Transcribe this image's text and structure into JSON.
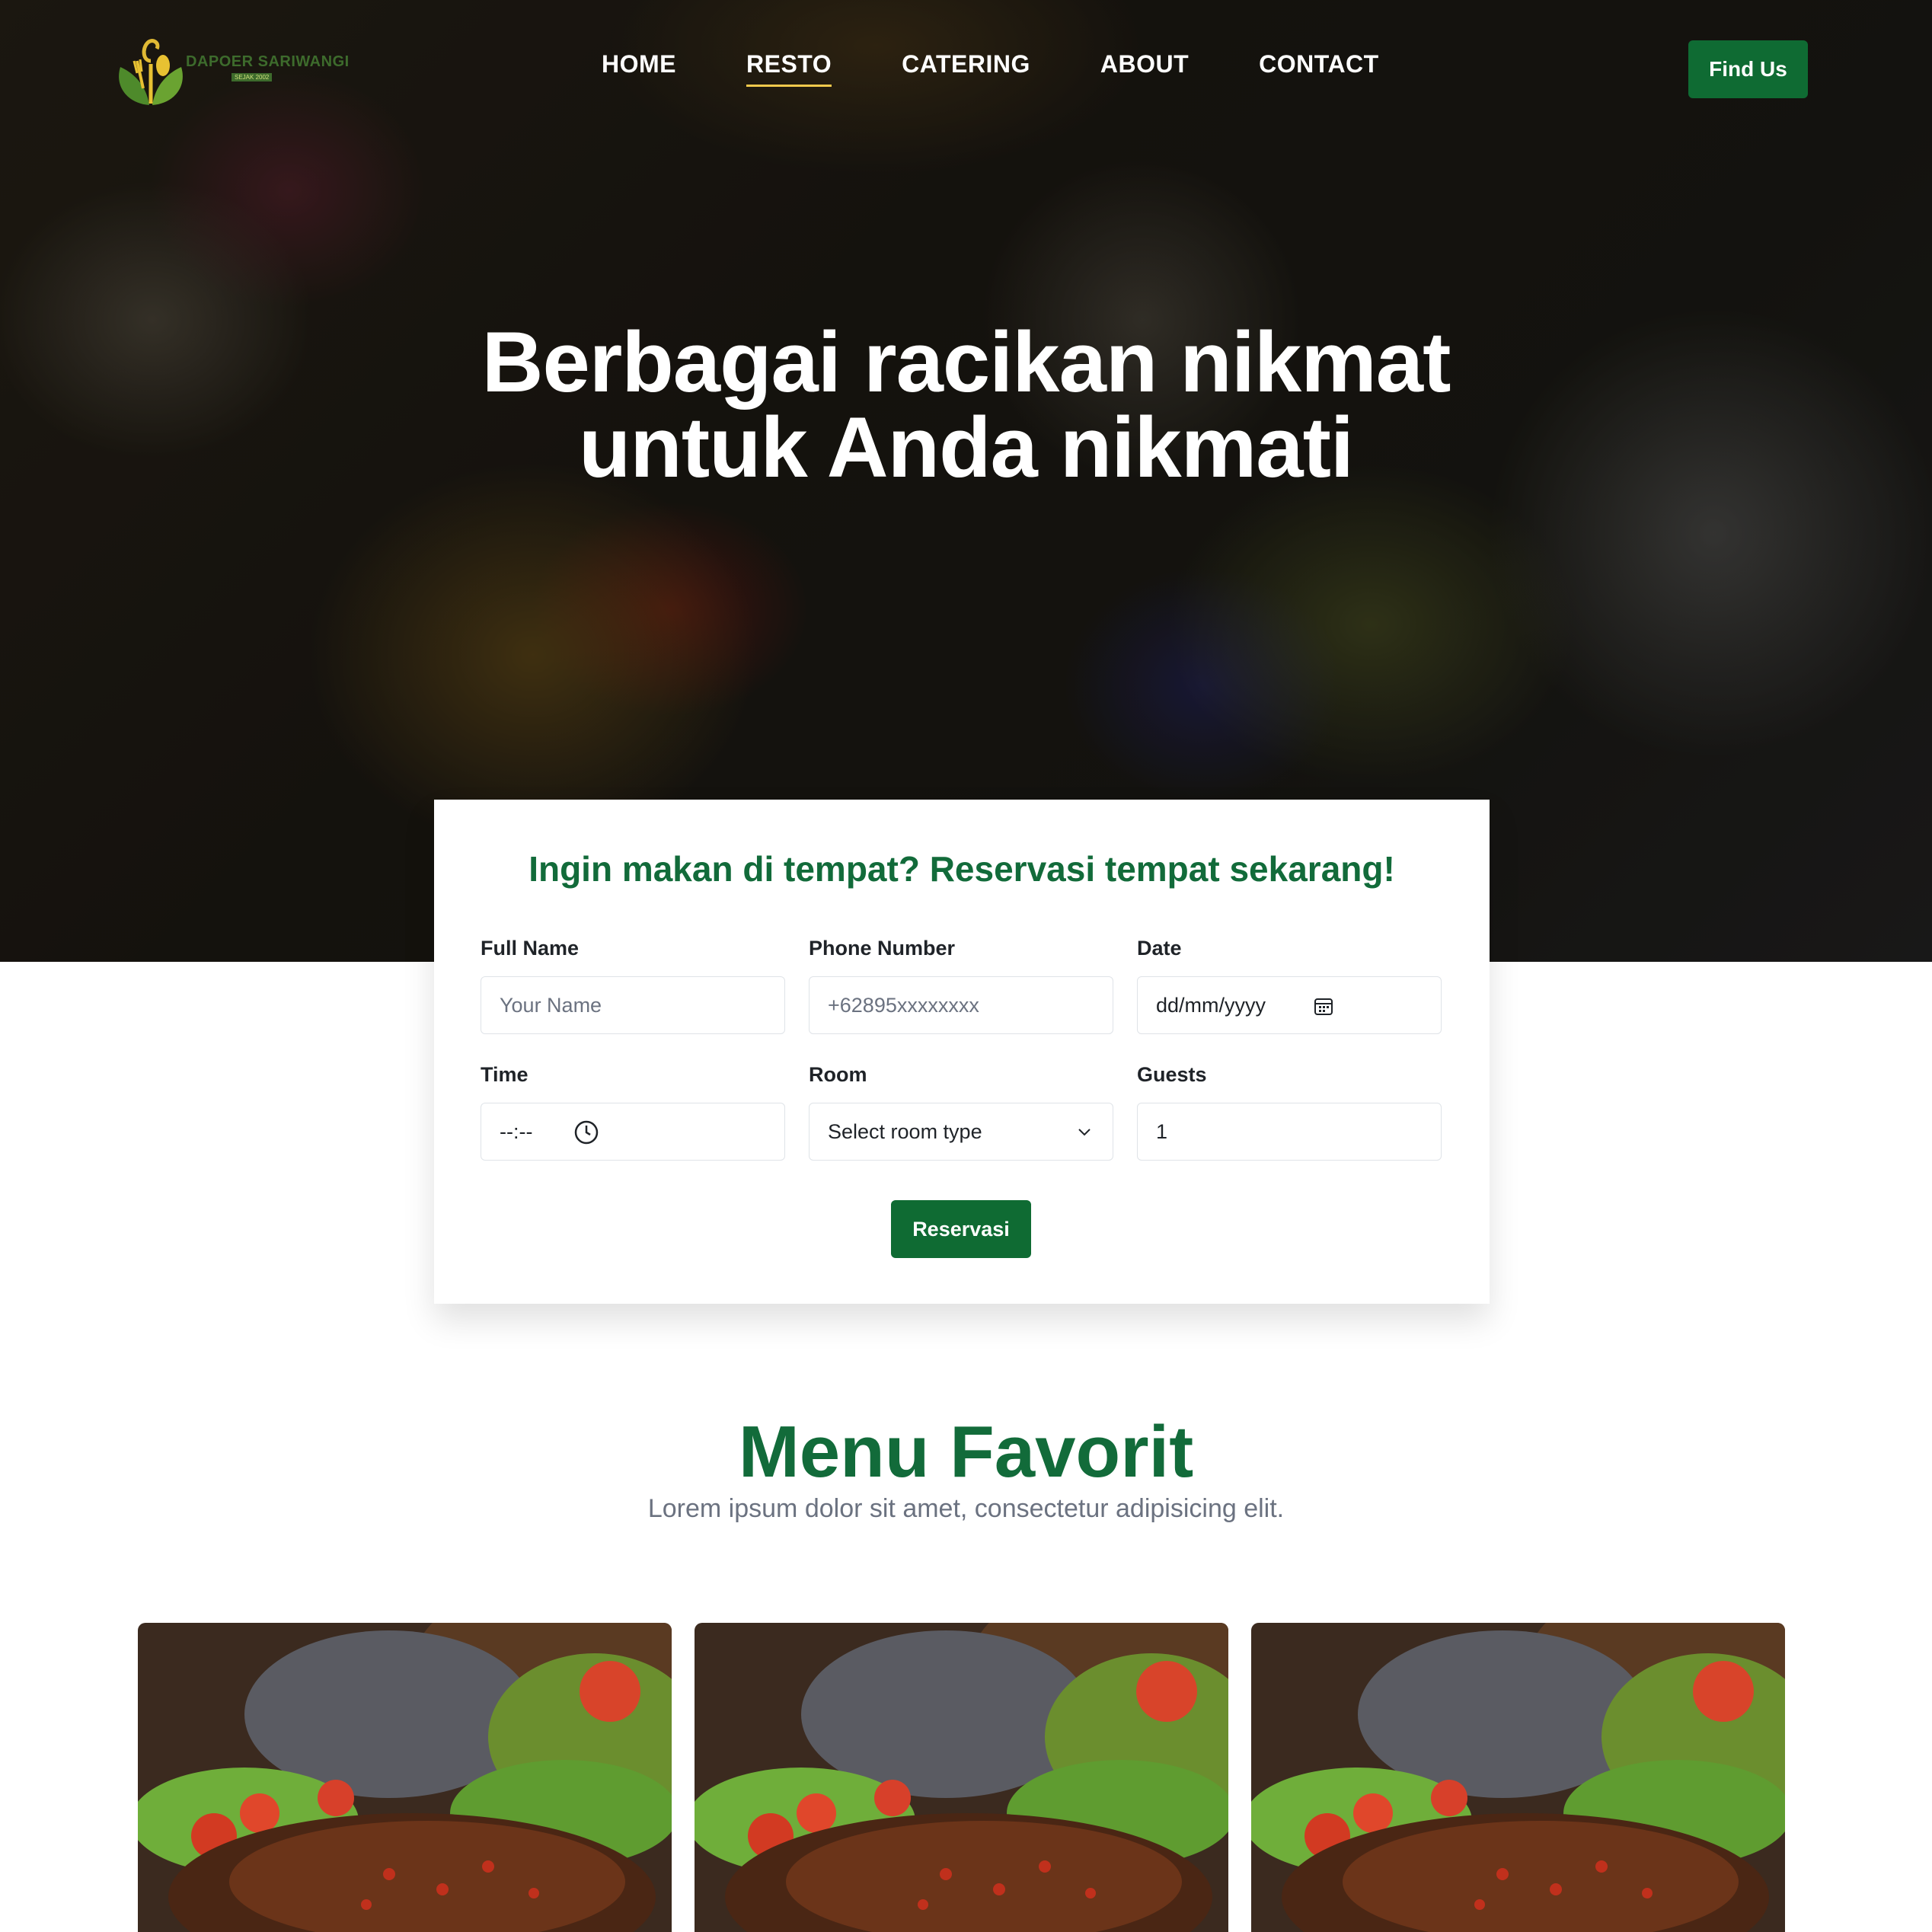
{
  "brand": {
    "name": "DAPOER SARIWANGI",
    "tagline": "SEJAK 2002"
  },
  "nav": {
    "items": [
      {
        "label": "HOME",
        "active": false
      },
      {
        "label": "RESTO",
        "active": true
      },
      {
        "label": "CATERING",
        "active": false
      },
      {
        "label": "ABOUT",
        "active": false
      },
      {
        "label": "CONTACT",
        "active": false
      }
    ],
    "cta_label": "Find Us"
  },
  "hero": {
    "title_line1": "Berbagai racikan nikmat",
    "title_line2": "untuk Anda nikmati"
  },
  "reservation": {
    "title_normal": "Ingin makan di tempat?",
    "title_bold": "Reservasi tempat sekarang!",
    "fields": {
      "full_name": {
        "label": "Full Name",
        "placeholder": "Your Name"
      },
      "phone": {
        "label": "Phone Number",
        "placeholder": "+62895xxxxxxxx"
      },
      "date": {
        "label": "Date",
        "placeholder": "dd/mm/yyyy"
      },
      "time": {
        "label": "Time",
        "placeholder": "--:--"
      },
      "room": {
        "label": "Room",
        "selected": "Select room type"
      },
      "guests": {
        "label": "Guests",
        "value": "1"
      }
    },
    "submit_label": "Reservasi"
  },
  "menu": {
    "title": "Menu Favorit",
    "subtitle": "Lorem ipsum dolor sit amet, consectetur adipisicing elit.",
    "cards": [
      {
        "image": "grilled-fish-photo"
      },
      {
        "image": "grilled-fish-photo"
      },
      {
        "image": "grilled-fish-photo"
      }
    ]
  },
  "colors": {
    "brand_green": "#0f6b33",
    "title_green": "#126b3a",
    "active_underline": "#f2c94c"
  }
}
